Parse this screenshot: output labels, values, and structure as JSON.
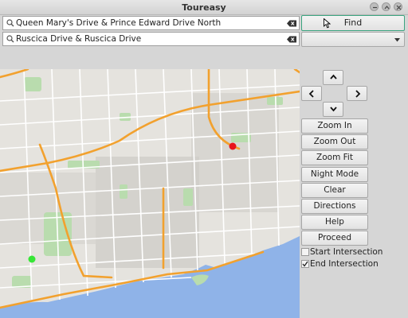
{
  "window": {
    "title": "Toureasy",
    "controls": [
      "minimize-icon",
      "maximize-icon",
      "close-icon"
    ]
  },
  "search": {
    "start_value": "Queen Mary's Drive & Prince Edward Drive North",
    "end_value": "Ruscica Drive & Ruscica Drive",
    "search_icon": "search-icon",
    "clear_icon": "backspace-icon"
  },
  "find_button": {
    "label": "Find"
  },
  "dropdown": {
    "selected": ""
  },
  "nav": {
    "up_icon": "chevron-up-icon",
    "left_icon": "chevron-left-icon",
    "right_icon": "chevron-right-icon",
    "down_icon": "chevron-down-icon"
  },
  "buttons": {
    "zoom_in": "Zoom In",
    "zoom_out": "Zoom Out",
    "zoom_fit": "Zoom Fit",
    "night_mode": "Night Mode",
    "clear": "Clear",
    "directions": "Directions",
    "help": "Help",
    "proceed": "Proceed"
  },
  "checkboxes": {
    "start": {
      "label": "Start Intersection",
      "checked": false
    },
    "end": {
      "label": "End Intersection",
      "checked": true
    }
  },
  "map": {
    "markers": [
      {
        "name": "end-marker",
        "color": "#e8141c"
      },
      {
        "name": "start-marker",
        "color": "#37e637"
      }
    ],
    "colors": {
      "land": "#e7e5e0",
      "road": "#ffffff",
      "highway": "#f2a12e",
      "park": "#b9dcae",
      "water": "#8fb3e8",
      "dense": "#cfcdc8"
    }
  }
}
